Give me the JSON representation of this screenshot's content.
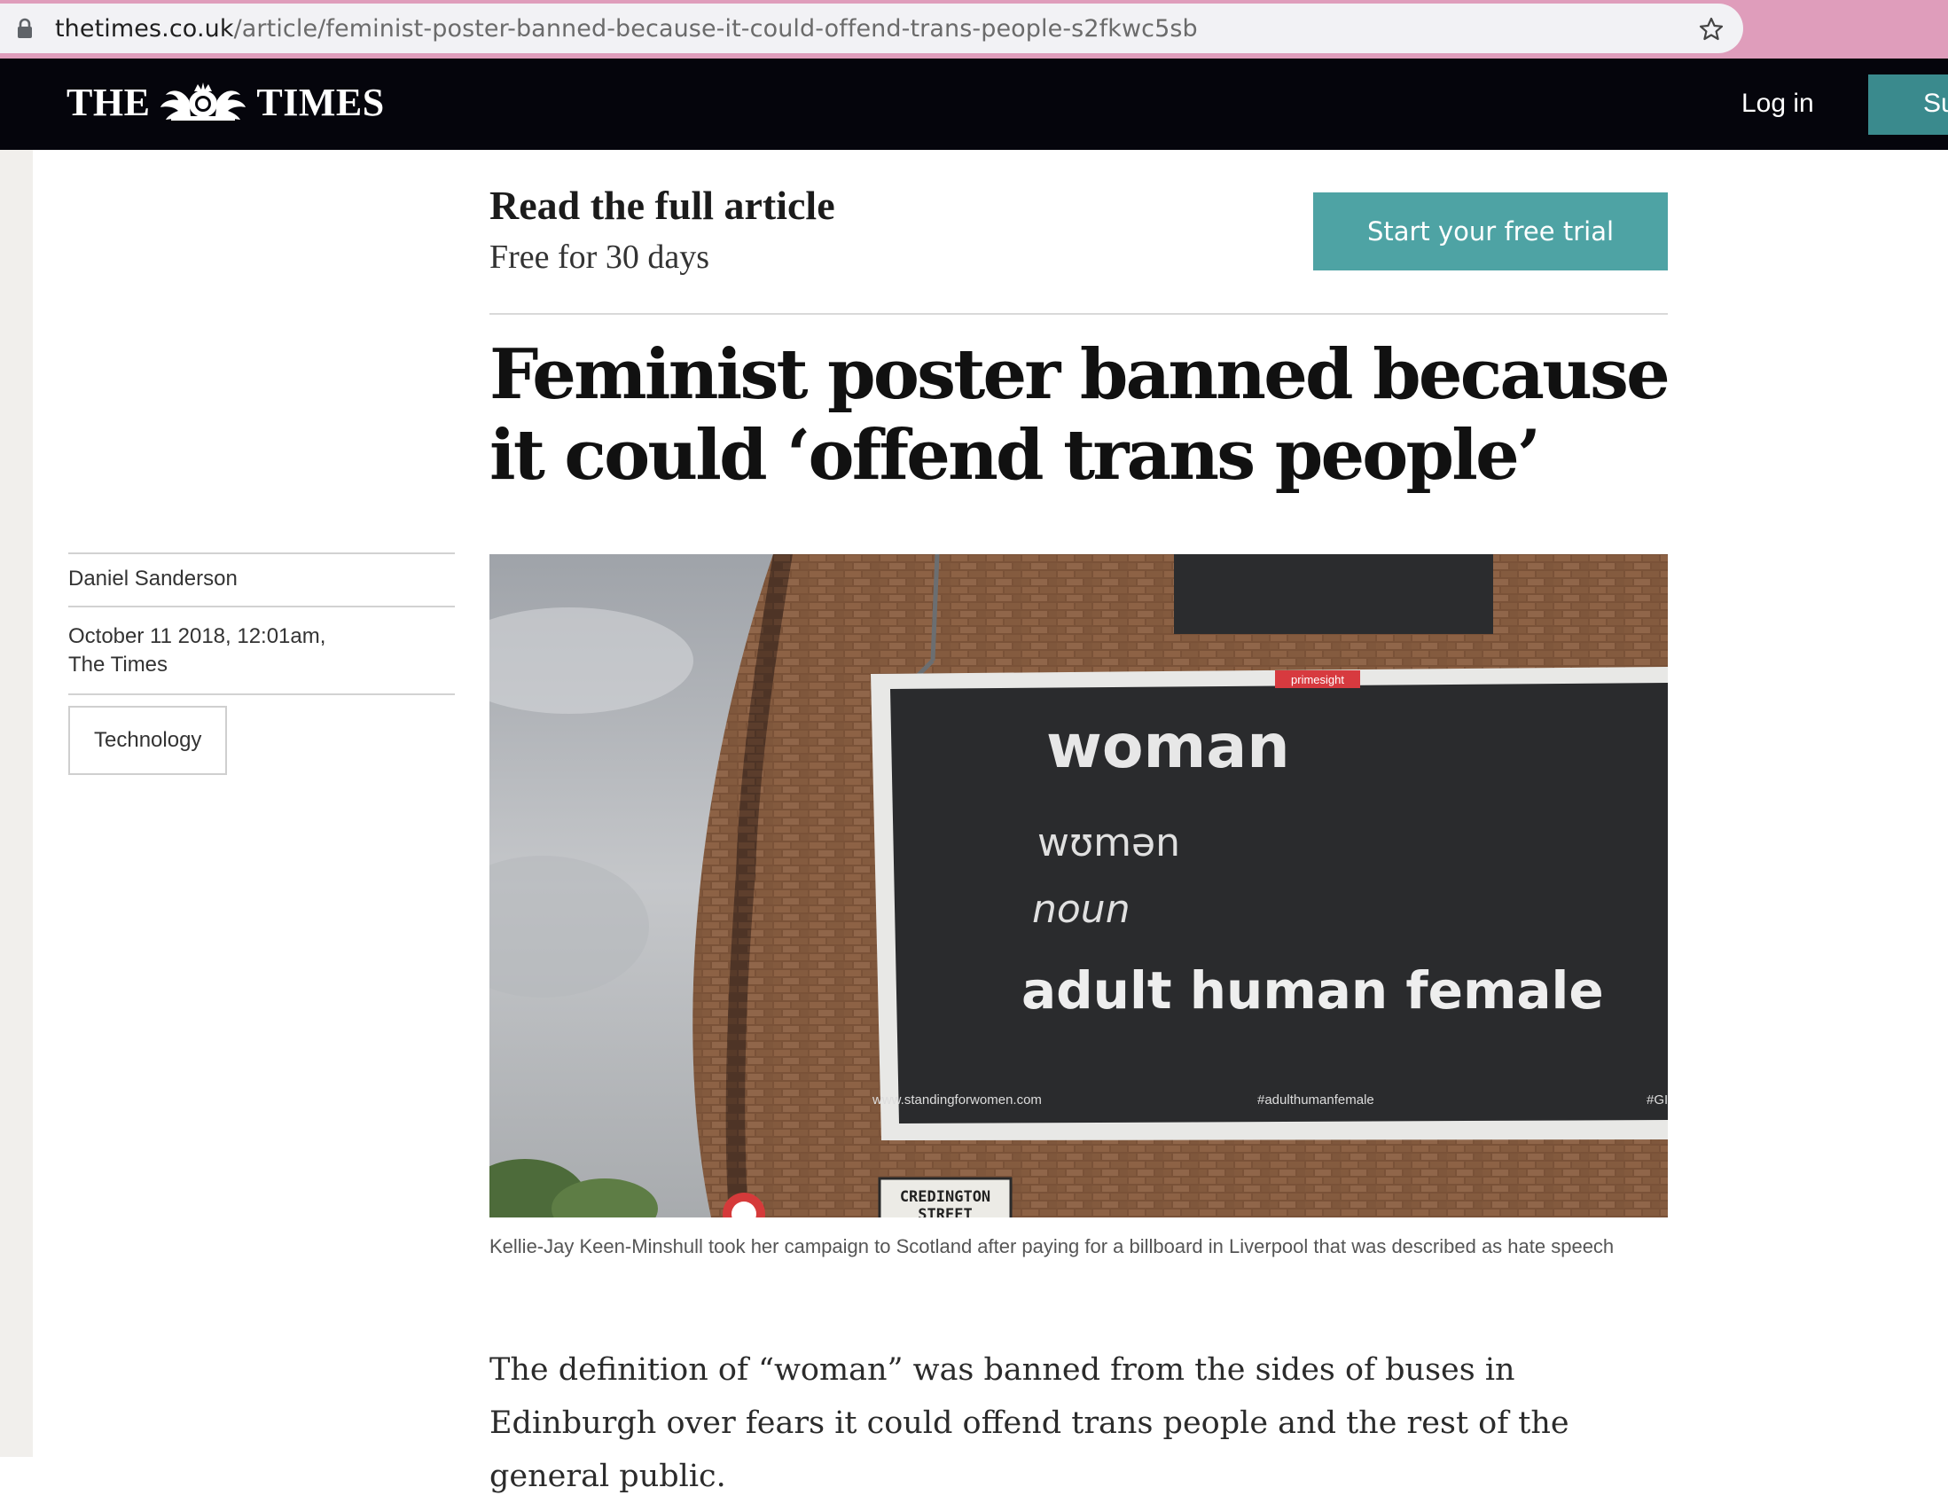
{
  "browser": {
    "url_host": "thetimes.co.uk",
    "url_path": "/article/feminist-poster-banned-because-it-could-offend-trans-people-s2fkwc5sb"
  },
  "masthead": {
    "logo_left": "THE",
    "logo_right": "TIMES",
    "login_label": "Log in",
    "subscribe_label": "Su"
  },
  "promo": {
    "title": "Read the full article",
    "subtitle": "Free for 30 days",
    "button_label": "Start your free trial"
  },
  "article": {
    "headline": "Feminist poster banned because it could ‘offend trans people’",
    "author": "Daniel Sanderson",
    "date": "October 11 2018, 12:01am,",
    "publication": "The Times",
    "tag": "Technology",
    "caption": "Kellie-Jay Keen-Minshull took her campaign to Scotland after paying for a billboard in Liverpool that was described as hate speech",
    "body": "The definition of “woman” was banned from the sides of buses in Edinburgh over fears it could offend trans people and the rest of the general public."
  },
  "photo": {
    "billboard_brand": "primesight",
    "line_word": "woman",
    "line_phonetic": "wʊmən",
    "line_pos": "noun",
    "line_definition": "adult human female",
    "footer_url": "www.standingforwomen.com",
    "footer_hashtag": "#adulthumanfemale",
    "footer_cut": "#GI",
    "street_sign_1": "CREDINGTON",
    "street_sign_2": "STREET"
  },
  "colors": {
    "browser_bar": "#df9dbb",
    "masthead": "#05050c",
    "accent_teal": "#4ea3a4"
  }
}
